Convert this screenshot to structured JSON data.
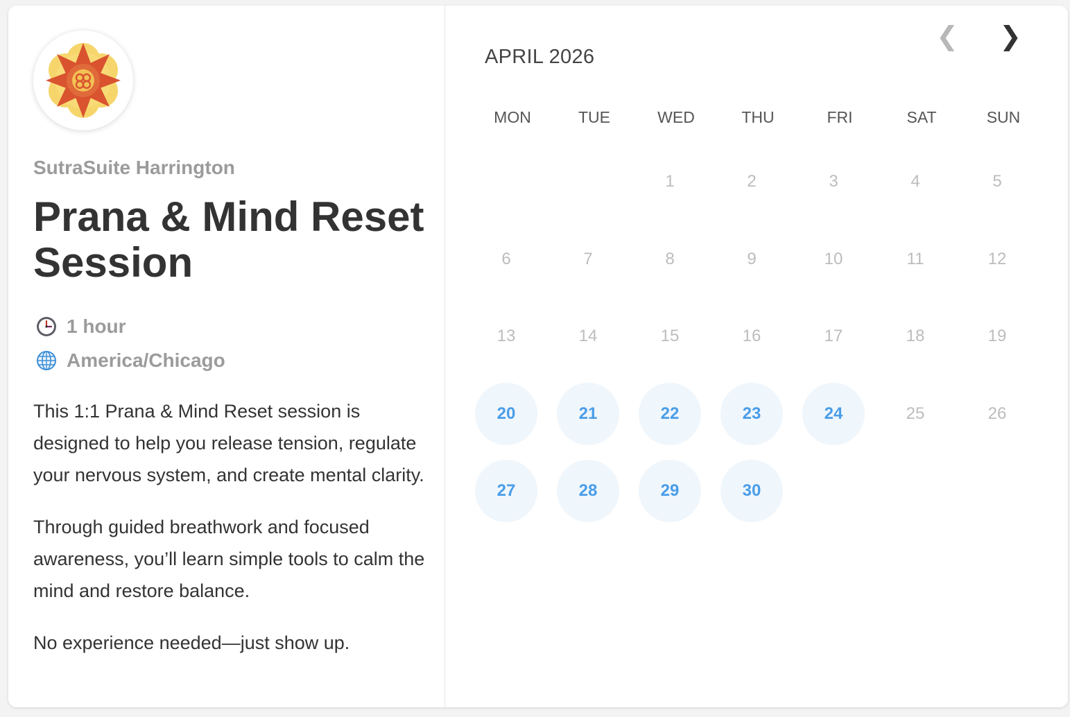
{
  "organization": {
    "name": "SutraSuite Harrington",
    "logo_icon": "lotus-mandala-logo"
  },
  "event": {
    "title": "Prana & Mind Reset Session",
    "duration": "1 hour",
    "duration_icon": "clock-icon",
    "timezone": "America/Chicago",
    "timezone_icon": "globe-icon",
    "description": [
      "This 1:1 Prana & Mind Reset session is designed to help you release tension, regulate your nervous system, and create mental clarity.",
      "Through guided breathwork and focused awareness, you’ll learn simple tools to calm the mind and restore balance.",
      "No experience needed—just show up."
    ]
  },
  "calendar": {
    "month_label": "APRIL 2026",
    "prev_icon": "chevron-left-icon",
    "next_icon": "chevron-right-icon",
    "prev_glyph": "❮",
    "next_glyph": "❯",
    "weekdays": [
      "MON",
      "TUE",
      "WED",
      "THU",
      "FRI",
      "SAT",
      "SUN"
    ],
    "first_weekday_index": 2,
    "days_in_month": 30,
    "available_days": [
      20,
      21,
      22,
      23,
      24,
      27,
      28,
      29,
      30
    ],
    "colors": {
      "available_bg": "#eff6fc",
      "available_text": "#4a9de8",
      "unavailable_text": "#bcbcbc"
    }
  }
}
